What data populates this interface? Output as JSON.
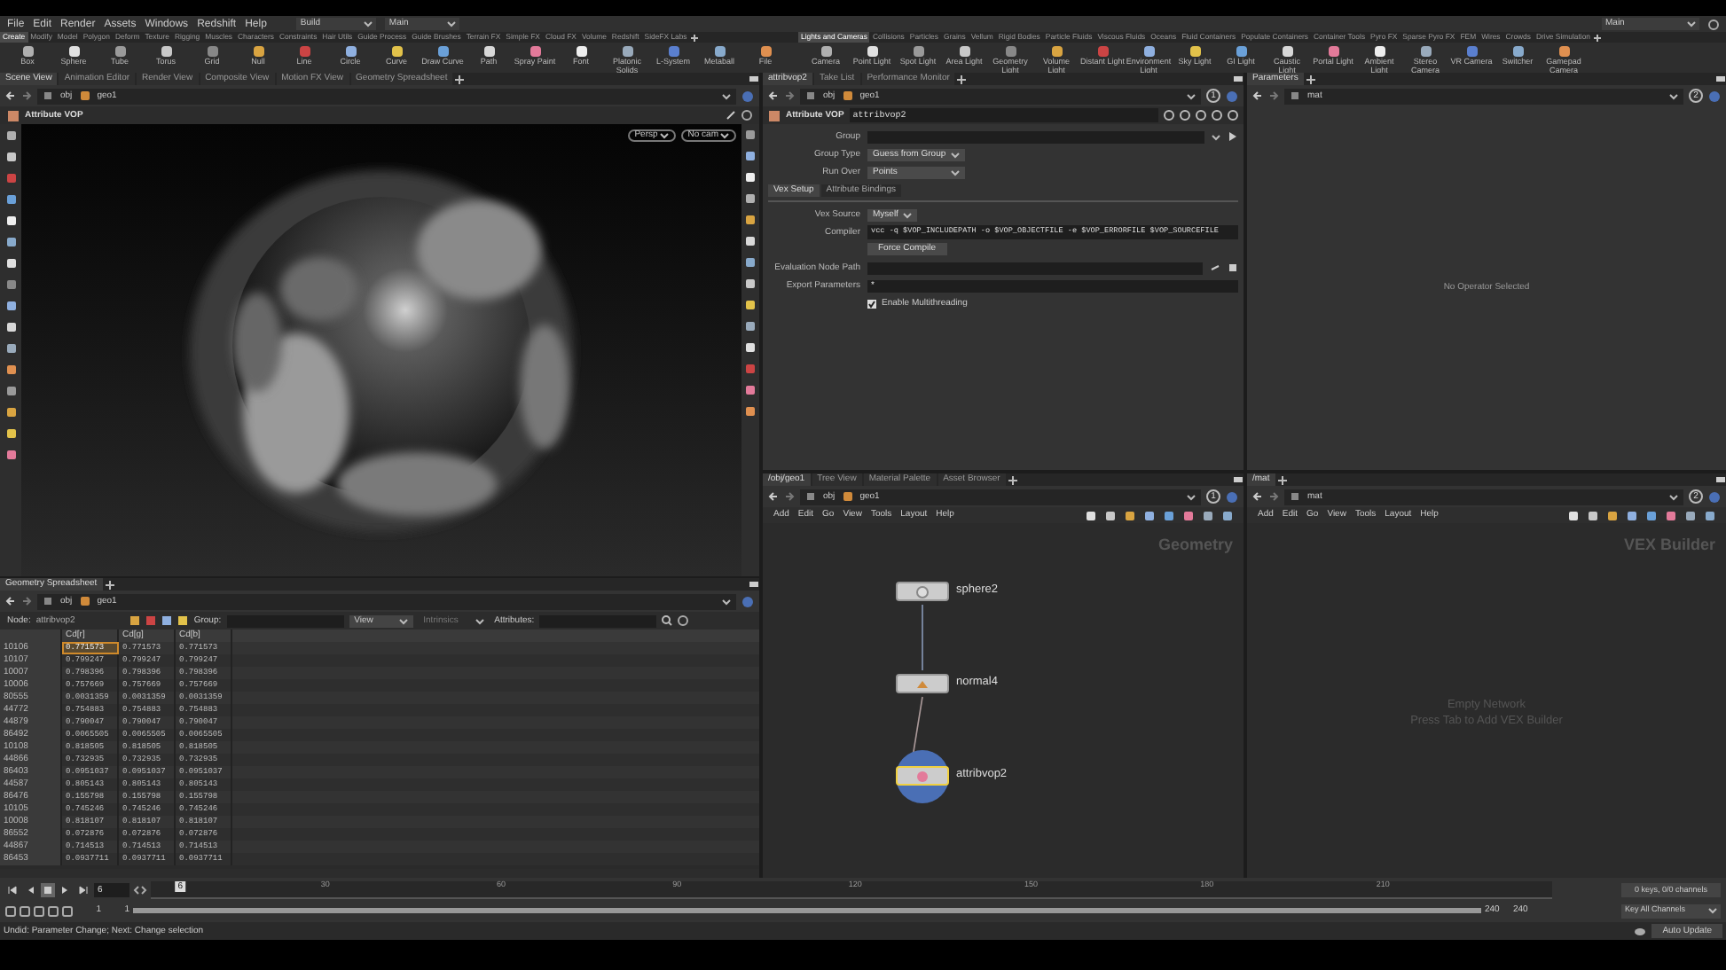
{
  "menu_bar": {
    "items": [
      "File",
      "Edit",
      "Render",
      "Assets",
      "Windows",
      "Redshift",
      "Help"
    ],
    "desktop": "Build",
    "context": "Main",
    "right_desktop": "Main"
  },
  "shelf_left": {
    "tabs": [
      {
        "label": "Create",
        "selected": true
      },
      {
        "label": "Modify",
        "selected": false
      },
      {
        "label": "Model",
        "selected": false
      },
      {
        "label": "Polygon",
        "selected": false
      },
      {
        "label": "Deform",
        "selected": false
      },
      {
        "label": "Texture",
        "selected": false
      },
      {
        "label": "Rigging",
        "selected": false
      },
      {
        "label": "Muscles",
        "selected": false
      },
      {
        "label": "Characters",
        "selected": false
      },
      {
        "label": "Constraints",
        "selected": false
      },
      {
        "label": "Hair Utils",
        "selected": false
      },
      {
        "label": "Guide Process",
        "selected": false
      },
      {
        "label": "Guide Brushes",
        "selected": false
      },
      {
        "label": "Terrain FX",
        "selected": false
      },
      {
        "label": "Simple FX",
        "selected": false
      },
      {
        "label": "Cloud FX",
        "selected": false
      },
      {
        "label": "Volume",
        "selected": false
      },
      {
        "label": "Redshift",
        "selected": false
      },
      {
        "label": "SideFX Labs",
        "selected": false
      }
    ],
    "tools": [
      "Box",
      "Sphere",
      "Tube",
      "Torus",
      "Grid",
      "Null",
      "Line",
      "Circle",
      "Curve",
      "Draw Curve",
      "Path",
      "Spray Paint",
      "Font",
      "Platonic Solids",
      "L-System",
      "Metaball",
      "File"
    ]
  },
  "shelf_right": {
    "tabs": [
      {
        "label": "Lights and Cameras",
        "selected": true
      },
      {
        "label": "Collisions",
        "selected": false
      },
      {
        "label": "Particles",
        "selected": false
      },
      {
        "label": "Grains",
        "selected": false
      },
      {
        "label": "Vellum",
        "selected": false
      },
      {
        "label": "Rigid Bodies",
        "selected": false
      },
      {
        "label": "Particle Fluids",
        "selected": false
      },
      {
        "label": "Viscous Fluids",
        "selected": false
      },
      {
        "label": "Oceans",
        "selected": false
      },
      {
        "label": "Fluid Containers",
        "selected": false
      },
      {
        "label": "Populate Containers",
        "selected": false
      },
      {
        "label": "Container Tools",
        "selected": false
      },
      {
        "label": "Pyro FX",
        "selected": false
      },
      {
        "label": "Sparse Pyro FX",
        "selected": false
      },
      {
        "label": "FEM",
        "selected": false
      },
      {
        "label": "Wires",
        "selected": false
      },
      {
        "label": "Crowds",
        "selected": false
      },
      {
        "label": "Drive Simulation",
        "selected": false
      }
    ],
    "tools": [
      "Camera",
      "Point Light",
      "Spot Light",
      "Area Light",
      "Geometry Light",
      "Volume Light",
      "Distant Light",
      "Environment Light",
      "Sky Light",
      "GI Light",
      "Caustic Light",
      "Portal Light",
      "Ambient Light",
      "Stereo Camera",
      "VR Camera",
      "Switcher",
      "Gamepad Camera"
    ]
  },
  "scene_view": {
    "tabs": [
      {
        "label": "Scene View",
        "selected": true
      },
      {
        "label": "Animation Editor",
        "selected": false
      },
      {
        "label": "Render View",
        "selected": false
      },
      {
        "label": "Composite View",
        "selected": false
      },
      {
        "label": "Motion FX View",
        "selected": false
      },
      {
        "label": "Geometry Spreadsheet",
        "selected": false
      }
    ],
    "path": [
      "obj",
      "geo1"
    ],
    "title": "Attribute VOP",
    "camera_menus": [
      "Persp",
      "No cam"
    ]
  },
  "spreadsheet": {
    "tabs": [
      {
        "label": "Geometry Spreadsheet",
        "selected": true
      }
    ],
    "path": [
      "obj",
      "geo1"
    ],
    "node_label": "Node:",
    "node": "attribvop2",
    "group_label": "Group:",
    "view": "View",
    "intrinsics": "Intrinsics",
    "attributes_label": "Attributes:",
    "columns": [
      "Cd[r]",
      "Cd[g]",
      "Cd[b]"
    ],
    "rows": [
      {
        "point": "10106",
        "values": [
          "0.771573",
          "0.771573",
          "0.771573"
        ],
        "selected": true
      },
      {
        "point": "10107",
        "values": [
          "0.799247",
          "0.799247",
          "0.799247"
        ],
        "selected": false
      },
      {
        "point": "10007",
        "values": [
          "0.798396",
          "0.798396",
          "0.798396"
        ],
        "selected": false
      },
      {
        "point": "10006",
        "values": [
          "0.757669",
          "0.757669",
          "0.757669"
        ],
        "selected": false
      },
      {
        "point": "80555",
        "values": [
          "0.0031359",
          "0.0031359",
          "0.0031359"
        ],
        "selected": false
      },
      {
        "point": "44772",
        "values": [
          "0.754883",
          "0.754883",
          "0.754883"
        ],
        "selected": false
      },
      {
        "point": "44879",
        "values": [
          "0.790047",
          "0.790047",
          "0.790047"
        ],
        "selected": false
      },
      {
        "point": "86492",
        "values": [
          "0.0065505",
          "0.0065505",
          "0.0065505"
        ],
        "selected": false
      },
      {
        "point": "10108",
        "values": [
          "0.818505",
          "0.818505",
          "0.818505"
        ],
        "selected": false
      },
      {
        "point": "44866",
        "values": [
          "0.732935",
          "0.732935",
          "0.732935"
        ],
        "selected": false
      },
      {
        "point": "86403",
        "values": [
          "0.0951037",
          "0.0951037",
          "0.0951037"
        ],
        "selected": false
      },
      {
        "point": "44587",
        "values": [
          "0.805143",
          "0.805143",
          "0.805143"
        ],
        "selected": false
      },
      {
        "point": "86476",
        "values": [
          "0.155798",
          "0.155798",
          "0.155798"
        ],
        "selected": false
      },
      {
        "point": "10105",
        "values": [
          "0.745246",
          "0.745246",
          "0.745246"
        ],
        "selected": false
      },
      {
        "point": "10008",
        "values": [
          "0.818107",
          "0.818107",
          "0.818107"
        ],
        "selected": false
      },
      {
        "point": "86552",
        "values": [
          "0.072876",
          "0.072876",
          "0.072876"
        ],
        "selected": false
      },
      {
        "point": "44867",
        "values": [
          "0.714513",
          "0.714513",
          "0.714513"
        ],
        "selected": false
      },
      {
        "point": "86453",
        "values": [
          "0.0937711",
          "0.0937711",
          "0.0937711"
        ],
        "selected": false
      }
    ]
  },
  "parameters": {
    "tabs": [
      {
        "label": "attribvop2",
        "selected": true
      },
      {
        "label": "Take List",
        "selected": false
      },
      {
        "label": "Performance Monitor",
        "selected": false
      }
    ],
    "path": [
      "obj",
      "geo1"
    ],
    "badge": "1",
    "node_type": "Attribute VOP",
    "node_name": "attribvop2",
    "group": {
      "label": "Group"
    },
    "group_type": {
      "label": "Group Type",
      "value": "Guess from Group"
    },
    "run_over": {
      "label": "Run Over",
      "value": "Points"
    },
    "folder_tabs": [
      {
        "label": "Vex Setup",
        "selected": true
      },
      {
        "label": "Attribute Bindings",
        "selected": false
      }
    ],
    "vex_source": {
      "label": "Vex Source",
      "value": "Myself"
    },
    "compiler": {
      "label": "Compiler",
      "value": "vcc -q $VOP_INCLUDEPATH -o $VOP_OBJECTFILE -e $VOP_ERRORFILE $VOP_SOURCEFILE"
    },
    "force_compile": "Force Compile",
    "evaluation_node_path": {
      "label": "Evaluation Node Path"
    },
    "export_parameters": {
      "label": "Export Parameters",
      "value": "*"
    },
    "multithreading": {
      "label": "Enable Multithreading",
      "checked": true
    }
  },
  "parameters_right": {
    "tabs": [
      {
        "label": "Parameters",
        "selected": true
      }
    ],
    "path": [
      "mat"
    ],
    "badge": "2",
    "message": "No Operator Selected"
  },
  "network_left": {
    "tabs": [
      {
        "label": "/obj/geo1",
        "selected": true
      },
      {
        "label": "Tree View",
        "selected": false
      },
      {
        "label": "Material Palette",
        "selected": false
      },
      {
        "label": "Asset Browser",
        "selected": false
      }
    ],
    "path": [
      "obj",
      "geo1"
    ],
    "badge": "1",
    "menus": [
      "Add",
      "Edit",
      "Go",
      "View",
      "Tools",
      "Layout",
      "Help"
    ],
    "context_label": "Geometry",
    "nodes": [
      {
        "name": "sphere2",
        "selected": false
      },
      {
        "name": "normal4",
        "selected": false
      },
      {
        "name": "attribvop2",
        "selected": true
      }
    ]
  },
  "network_right": {
    "tabs": [
      {
        "label": "/mat",
        "selected": true
      }
    ],
    "path": [
      "mat"
    ],
    "badge": "2",
    "menus": [
      "Add",
      "Edit",
      "Go",
      "View",
      "Tools",
      "Layout",
      "Help"
    ],
    "context_label": "VEX Builder",
    "empty_title": "Empty Network",
    "empty_hint": "Press Tab to Add VEX Builder"
  },
  "timeline": {
    "frame": "6",
    "ticks": [
      "30",
      "60",
      "90",
      "120",
      "150",
      "180",
      "210"
    ],
    "playhead": {
      "label": "6",
      "level": 0.021
    },
    "range_start": [
      "1",
      "1"
    ],
    "range_end": [
      "240",
      "240"
    ],
    "range": {
      "level": 1
    },
    "keys": "0 keys, 0/0 channels",
    "key_mode": "Key All Channels"
  },
  "status_bar": {
    "message": "Undid: Parameter Change; Next: Change selection",
    "auto_update": "Auto Update"
  }
}
